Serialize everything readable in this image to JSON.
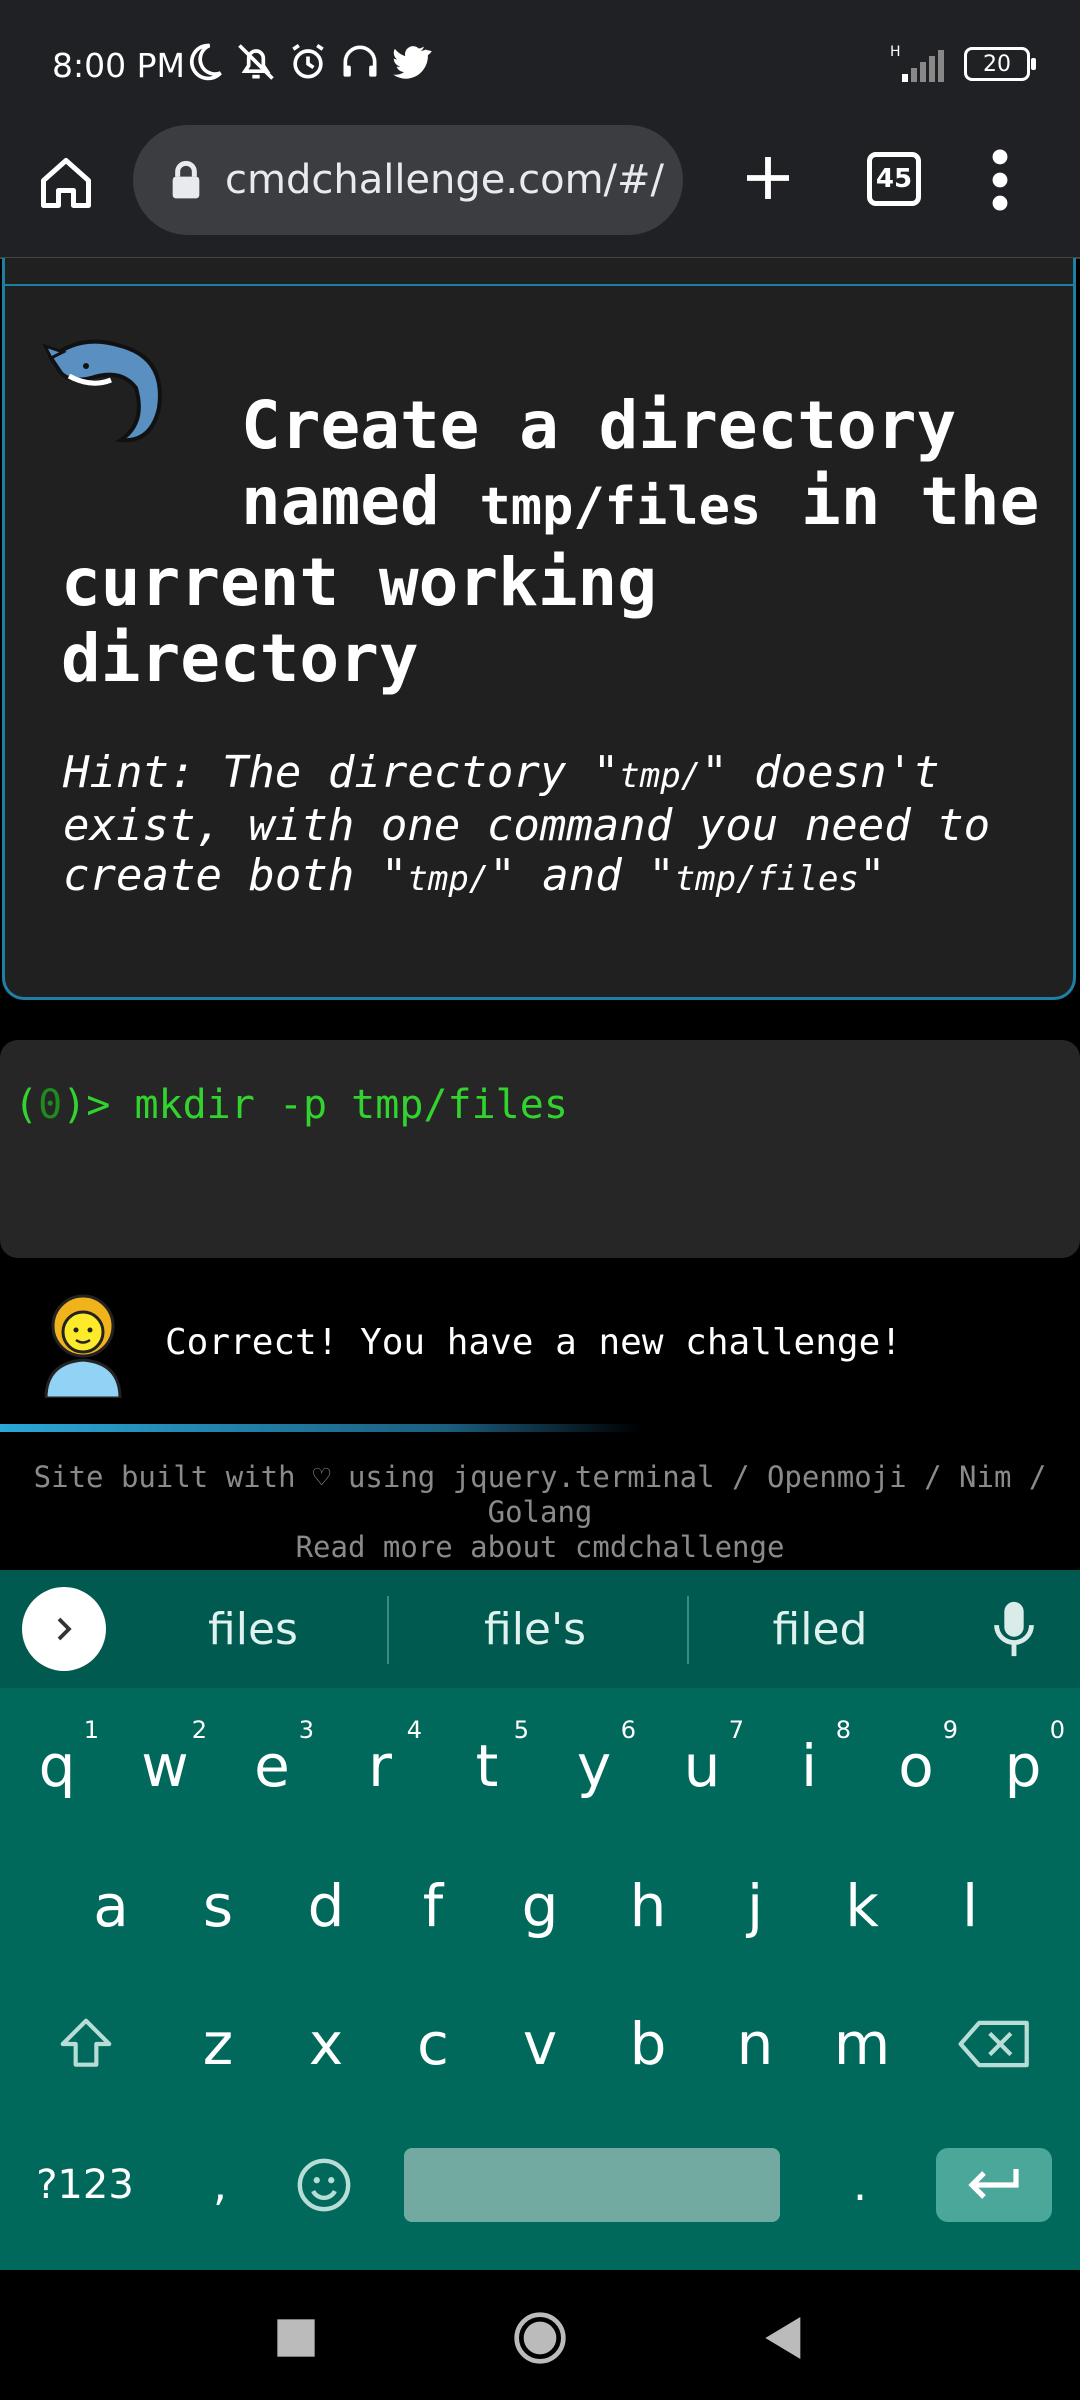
{
  "status": {
    "time": "8:00 PM",
    "network": "H",
    "battery": "20"
  },
  "browser": {
    "url": "cmdchallenge.com/#/",
    "tab_count": "45"
  },
  "challenge": {
    "title_line1": "Create a directory",
    "title_named": "named",
    "title_code": "tmp/files",
    "title_in_the": "in the",
    "title_line3": "current working",
    "title_line4": "directory",
    "hint_1": "Hint: The directory \"",
    "hint_code1": "tmp/",
    "hint_2": "\" doesn't",
    "hint_3": "exist, with one command you need to",
    "hint_4": "create both \"",
    "hint_code2": "tmp/",
    "hint_5": "\" and \"",
    "hint_code3": "tmp/files",
    "hint_6": "\""
  },
  "terminal": {
    "prompt_open": "(",
    "prompt_num": "0",
    "prompt_close": ")> ",
    "command": "mkdir -p tmp/files"
  },
  "result": {
    "message": "Correct! You have a new challenge!"
  },
  "footer": {
    "line1": "Site built with ♡ using jquery.terminal / Openmoji / Nim /",
    "line2": "Golang",
    "line3": "Read more about cmdchallenge"
  },
  "keyboard": {
    "suggestions": [
      "files",
      "file's",
      "filed"
    ],
    "row1": [
      {
        "k": "q",
        "s": "1"
      },
      {
        "k": "w",
        "s": "2"
      },
      {
        "k": "e",
        "s": "3"
      },
      {
        "k": "r",
        "s": "4"
      },
      {
        "k": "t",
        "s": "5"
      },
      {
        "k": "y",
        "s": "6"
      },
      {
        "k": "u",
        "s": "7"
      },
      {
        "k": "i",
        "s": "8"
      },
      {
        "k": "o",
        "s": "9"
      },
      {
        "k": "p",
        "s": "0"
      }
    ],
    "row2": [
      "a",
      "s",
      "d",
      "f",
      "g",
      "h",
      "j",
      "k",
      "l"
    ],
    "row3": [
      "z",
      "x",
      "c",
      "v",
      "b",
      "n",
      "m"
    ],
    "sym_label": "?123",
    "comma": ",",
    "period": "."
  },
  "colors": {
    "accent": "#1e7fa5",
    "terminal_green": "#32d32e",
    "keyboard_bg": "#00695c"
  }
}
